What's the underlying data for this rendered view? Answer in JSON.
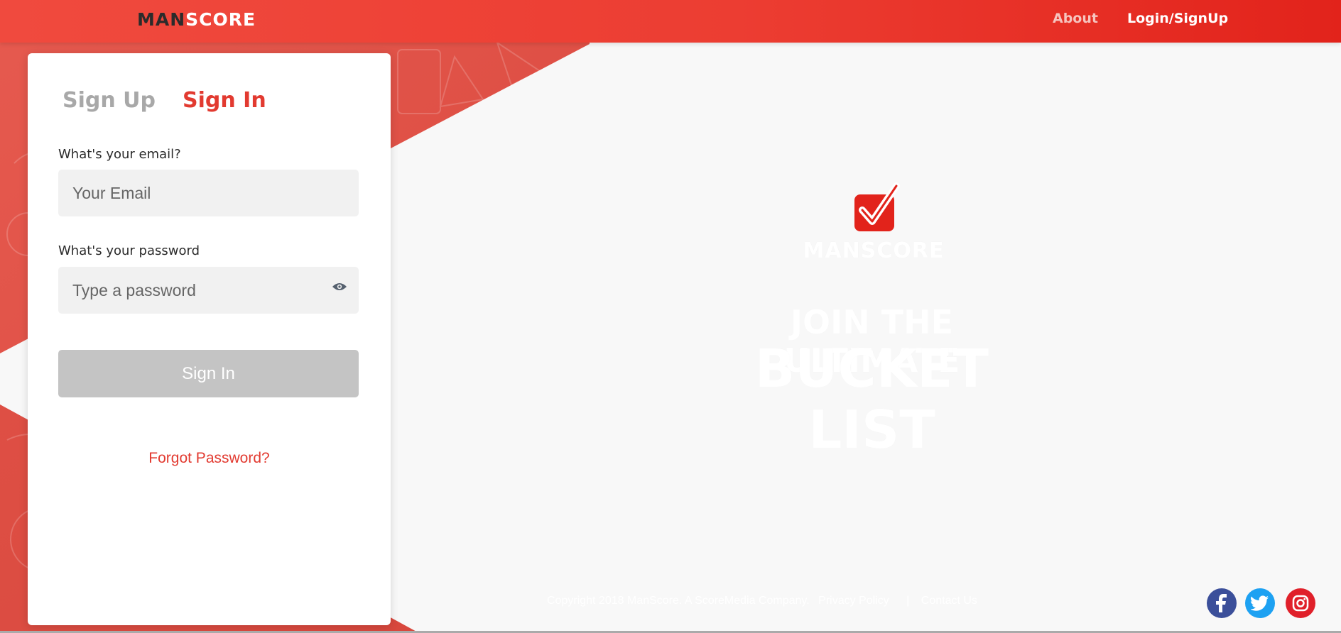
{
  "header": {
    "logo": {
      "part1": "MAN",
      "part2": "SCORE"
    },
    "nav": [
      {
        "label": "About"
      },
      {
        "label": "Login/SignUp"
      }
    ]
  },
  "auth": {
    "tabs": [
      {
        "label": "Sign Up",
        "active": false
      },
      {
        "label": "Sign In",
        "active": true
      }
    ],
    "email": {
      "label": "What's your email?",
      "placeholder": "Your Email",
      "value": ""
    },
    "password": {
      "label": "What's your password",
      "placeholder": "Type a password",
      "value": ""
    },
    "submit_label": "Sign In",
    "forgot_label": "Forgot Password?"
  },
  "brand": {
    "name": "MANSCORE",
    "tagline_line1": "JOIN THE ULTIMATE",
    "tagline_line2": "BUCKET LIST"
  },
  "footer": {
    "copyright": "Copyright 2018 ManScore. A ScoreMedia Company.",
    "privacy": "Privacy Policy",
    "contact": "Contact Us"
  },
  "social": [
    {
      "name": "facebook",
      "icon": "facebook-icon"
    },
    {
      "name": "twitter",
      "icon": "twitter-icon"
    },
    {
      "name": "instagram",
      "icon": "instagram-icon"
    }
  ],
  "colors": {
    "accent": "#e23a30",
    "header_start": "#f04a3e",
    "header_end": "#e2231b",
    "button_disabled": "#c4c4c4",
    "facebook": "#3b4f9a",
    "twitter": "#1da1f2",
    "instagram": "#e0202a"
  }
}
